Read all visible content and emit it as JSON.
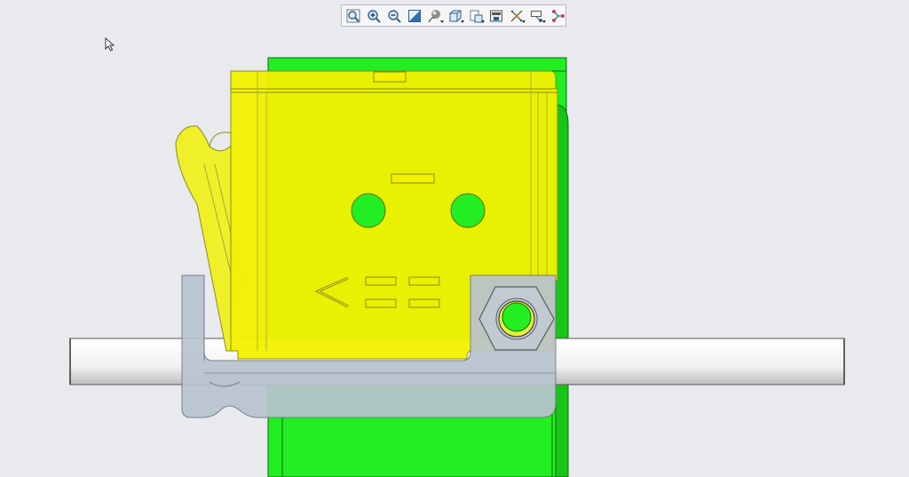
{
  "viewer": {
    "toolbar": {
      "buttons": [
        {
          "id": "zoom-fit",
          "icon": "zoom-fit-icon"
        },
        {
          "id": "zoom-in",
          "icon": "zoom-in-icon"
        },
        {
          "id": "zoom-out",
          "icon": "zoom-out-icon"
        },
        {
          "id": "view-orientation",
          "icon": "view-orientation-icon"
        },
        {
          "id": "display-style",
          "icon": "display-style-icon",
          "has_menu": true
        },
        {
          "id": "standard-views",
          "icon": "cube-view-icon",
          "has_menu": true
        },
        {
          "id": "saved-views",
          "icon": "saved-views-icon",
          "has_menu": true
        },
        {
          "id": "view-manager",
          "icon": "view-manager-icon"
        },
        {
          "id": "perspective",
          "icon": "perspective-icon",
          "has_menu": true
        },
        {
          "id": "annotation-display",
          "icon": "annotation-display-icon",
          "has_menu": true
        },
        {
          "id": "datum-display",
          "icon": "datum-display-icon"
        }
      ]
    },
    "colors": {
      "background": "#e9eaee",
      "frame_part": "#22ee22",
      "housing_part": "#f0f000",
      "clamp_part": "#b8c2ce",
      "rod": "#ffffff",
      "nut": "#c0c6cd"
    }
  }
}
